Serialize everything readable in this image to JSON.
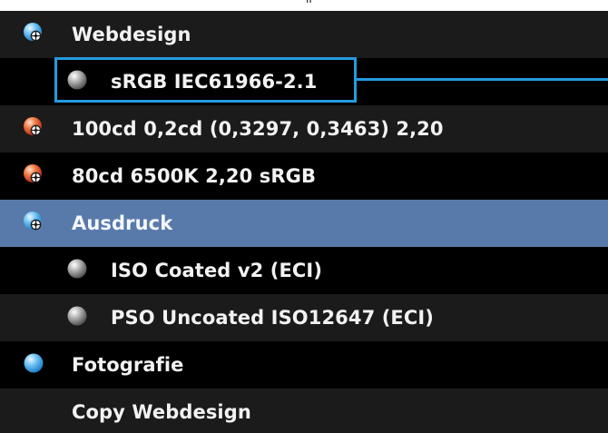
{
  "profile_list": {
    "items": [
      {
        "label": "Webdesign",
        "icon": "globe-crosshair-blue-icon",
        "level": 0,
        "selected": false
      },
      {
        "label": "sRGB IEC61966-2.1",
        "icon": "gray-profile-dot-icon",
        "level": 1,
        "selected": false,
        "highlighted": true
      },
      {
        "label": "100cd 0,2cd  (0,3297, 0,3463) 2,20",
        "icon": "globe-crosshair-orange-icon",
        "level": 0,
        "selected": false
      },
      {
        "label": "80cd 6500K 2,20 sRGB",
        "icon": "globe-crosshair-orange-icon",
        "level": 0,
        "selected": false
      },
      {
        "label": "Ausdruck",
        "icon": "globe-crosshair-blue-icon",
        "level": 0,
        "selected": true
      },
      {
        "label": "ISO Coated v2 (ECI)",
        "icon": "gray-profile-dot-icon",
        "level": 1,
        "selected": false
      },
      {
        "label": "PSO Uncoated ISO12647 (ECI)",
        "icon": "gray-profile-dot-icon",
        "level": 1,
        "selected": false
      },
      {
        "label": "Fotografie",
        "icon": "blue-folder-dot-icon",
        "level": 0,
        "selected": false
      },
      {
        "label": "Copy Webdesign",
        "icon": "",
        "level": 0,
        "selected": false
      }
    ]
  },
  "highlight": {
    "target_label": "sRGB IEC61966-2.1",
    "color": "#249be0"
  },
  "colors": {
    "row_bg": "#000000",
    "row_bg_alt": "#1b1b1b",
    "selected_bg": "#587aab",
    "text": "#f2f2f2",
    "blue_icon": "#5eb7ef",
    "orange_icon": "#ef6a3a",
    "gray_icon": "#9a9a9a"
  }
}
